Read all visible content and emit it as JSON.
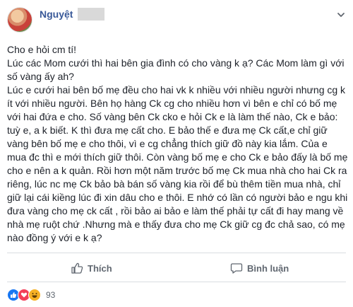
{
  "post": {
    "author": "Nguyệt",
    "paragraphs": [
      "Cho e hỏi cm tí!",
      "Lúc các Mom cưới thì hai bên gia đình có cho vàng k ạ? Các Mom làm gì với số vàng ấy ah?",
      "Lúc e cưới hai bên bố mẹ đều cho hai vk k nhiều với nhiều người nhưng cg k ít với nhiều người. Bên họ hàng Ck cg cho nhiều hơn vì bên e chỉ có bố mẹ với hai đứa e cho. Số vàng bên Ck cko e hỏi Ck e là làm thế nào, Ck e bảo: tuỳ e, a k biết. K thì đưa mẹ cất cho. E bảo thế e đưa mẹ Ck cất,e chỉ giữ vàng bên bố mẹ e cho thôi, vì e cg chẳng thích giữ đồ này kia lắm. Của e mua đc thì e mới thích giữ thôi. Còn vàng bố mẹ e cho Ck e bảo đấy là bố mẹ cho e nên a k quản. Rồi hơn một năm trước bố mẹ Ck mua nhà cho hai Ck ra riêng, lúc nc mẹ Ck bảo bà bán số vàng kia rồi để bù thêm tiền mua nhà, chỉ giữ lại cái kiềng lúc đi xin dâu cho e thôi. E nhớ có lần có người bảo e ngu khi đưa vàng cho mẹ ck cất , rồi bảo ai bảo e làm thế phải tự cất đi hay mang về nhà mẹ ruột chứ .Nhưng mà e thấy đưa cho mẹ Ck giữ cg đc chả sao, có mẹ nào đồng ý với e k ạ?"
    ]
  },
  "actions": {
    "like_label": "Thích",
    "comment_label": "Bình luận"
  },
  "reactions": {
    "count": "93",
    "types": [
      "like",
      "love",
      "haha"
    ]
  },
  "colors": {
    "author": "#385898",
    "text": "#1d2129",
    "muted": "#606770",
    "like": "#1877f2",
    "love": "#f33e58",
    "haha": "#f7b125"
  }
}
